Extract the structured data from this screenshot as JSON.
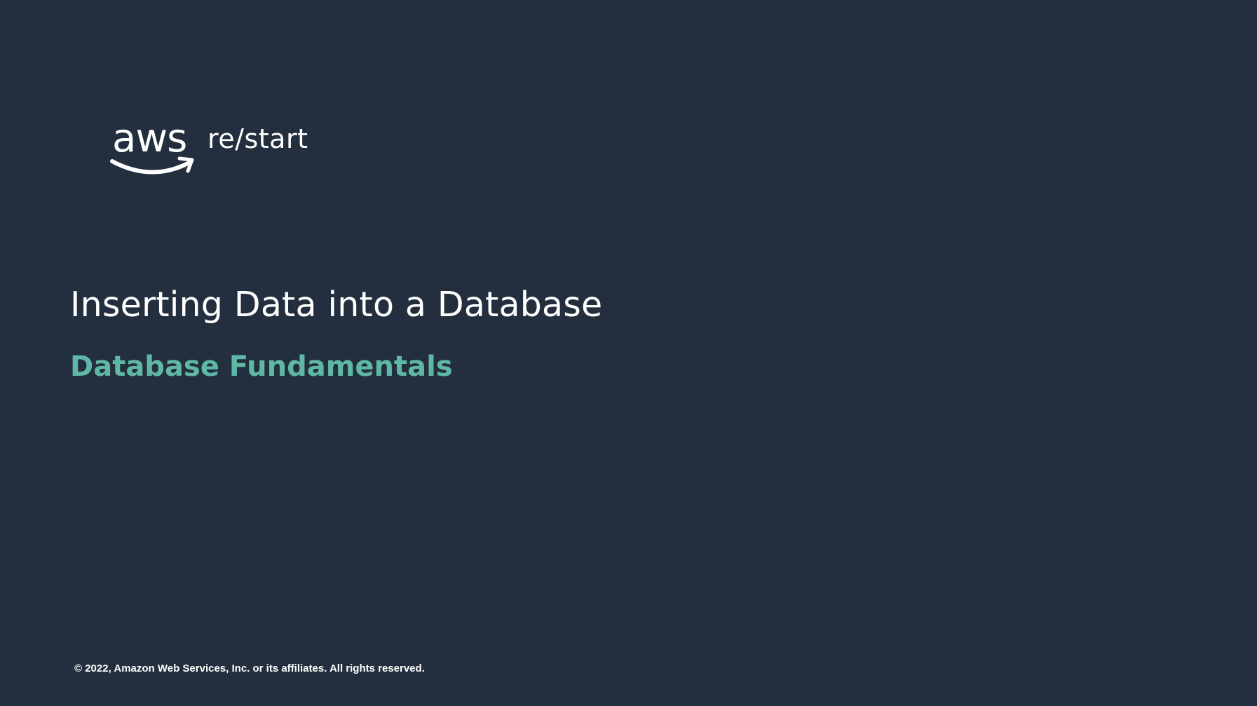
{
  "slide": {
    "logo": {
      "brand_mark": "aws",
      "product_text": "re/start",
      "smile_icon": "amazon-smile-arrow-icon"
    },
    "title": "Inserting Data into a Database",
    "subtitle": "Database Fundamentals",
    "copyright": "© 2022, Amazon Web Services, Inc. or its affiliates. All rights reserved."
  },
  "colors": {
    "background": "#232F3E",
    "title": "#FFFFFF",
    "subtitle_accent": "#5FB8A5"
  }
}
